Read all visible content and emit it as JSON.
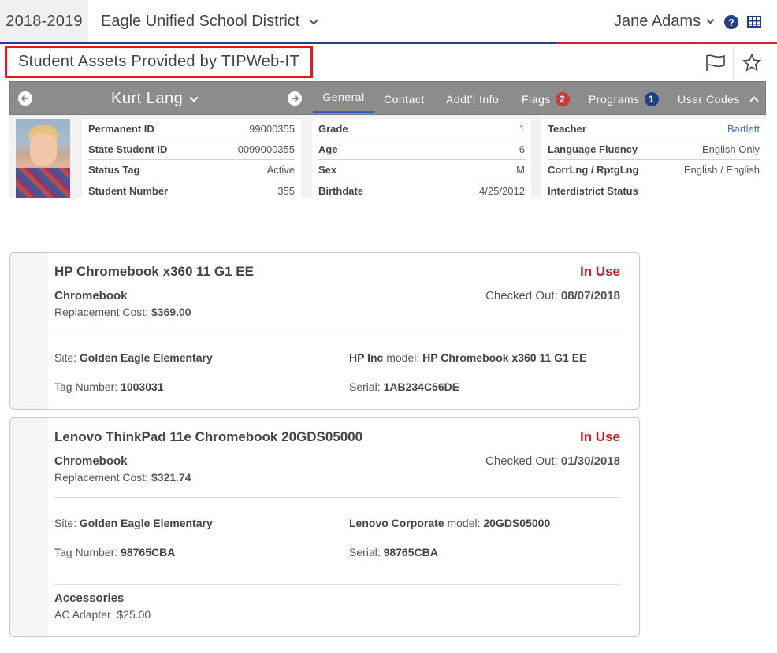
{
  "header": {
    "school_year": "2018-2019",
    "district": "Eagle Unified School District",
    "user_name": "Jane Adams",
    "colors": {
      "primary": "#233f8f",
      "accent": "#c5292f"
    }
  },
  "page": {
    "title": "Student Assets Provided by TIPWeb-IT"
  },
  "student_bar": {
    "name": "Kurt Lang",
    "tabs": [
      {
        "label": "General"
      },
      {
        "label": "Contact"
      },
      {
        "label": "Addt'l Info"
      },
      {
        "label": "Flags",
        "badge": "2"
      },
      {
        "label": "Programs",
        "badge": "1"
      },
      {
        "label": "User Codes"
      }
    ]
  },
  "student_info": {
    "col1": [
      {
        "label": "Permanent ID",
        "value": "99000355"
      },
      {
        "label": "State Student ID",
        "value": "0099000355"
      },
      {
        "label": "Status Tag",
        "value": "Active"
      },
      {
        "label": "Student Number",
        "value": "355"
      }
    ],
    "col2": [
      {
        "label": "Grade",
        "value": "1"
      },
      {
        "label": "Age",
        "value": "6"
      },
      {
        "label": "Sex",
        "value": "M"
      },
      {
        "label": "Birthdate",
        "value": "4/25/2012"
      }
    ],
    "col3": [
      {
        "label": "Teacher",
        "value": "Bartlett"
      },
      {
        "label": "Language Fluency",
        "value": "English Only"
      },
      {
        "label": "CorrLng / RptgLng",
        "value": "English / English"
      },
      {
        "label": "Interdistrict Status",
        "value": ""
      }
    ]
  },
  "assets": [
    {
      "name": "HP Chromebook x360 11 G1 EE",
      "status": "In Use",
      "type": "Chromebook",
      "checked_out_label": "Checked Out:",
      "checked_out_date": "08/07/2018",
      "replacement_label": "Replacement Cost:",
      "replacement_cost": "$369.00",
      "site_label": "Site:",
      "site": "Golden Eagle Elementary",
      "manufacturer": "HP Inc",
      "model_label": "model:",
      "model": "HP Chromebook x360 11 G1 EE",
      "tag_label": "Tag Number:",
      "tag": "1003031",
      "serial_label": "Serial:",
      "serial": "1AB234C56DE"
    },
    {
      "name": "Lenovo ThinkPad 11e Chromebook 20GDS05000",
      "status": "In Use",
      "type": "Chromebook",
      "checked_out_label": "Checked Out:",
      "checked_out_date": "01/30/2018",
      "replacement_label": "Replacement Cost:",
      "replacement_cost": "$321.74",
      "site_label": "Site:",
      "site": "Golden Eagle Elementary",
      "manufacturer": "Lenovo Corporate",
      "model_label": "model:",
      "model": "20GDS05000",
      "tag_label": "Tag Number:",
      "tag": "98765CBA",
      "serial_label": "Serial:",
      "serial": "98765CBA",
      "accessories_title": "Accessories",
      "accessories": [
        {
          "name": "AC Adapter",
          "price": "$25.00"
        }
      ]
    }
  ]
}
